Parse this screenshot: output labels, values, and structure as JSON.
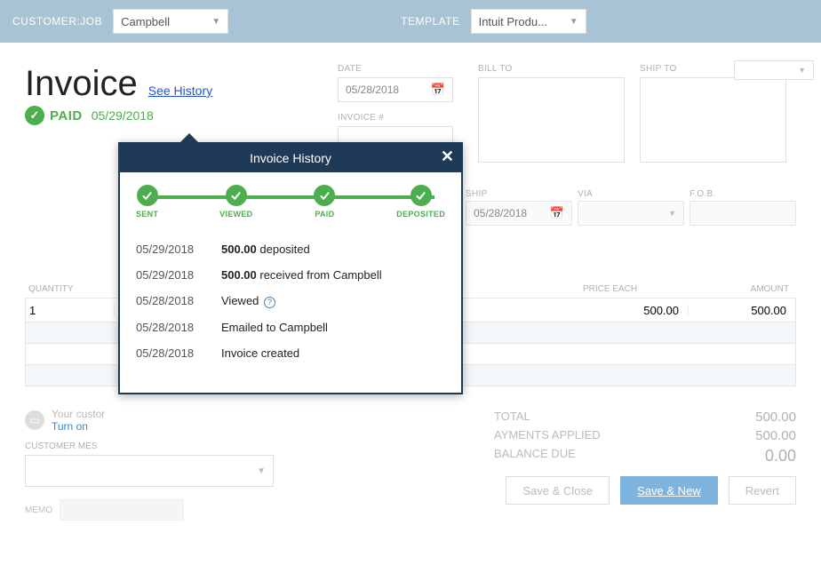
{
  "topbar": {
    "customer_label": "CUSTOMER:JOB",
    "customer_value": "Campbell",
    "template_label": "TEMPLATE",
    "template_value": "Intuit Produ..."
  },
  "header": {
    "title": "Invoice",
    "see_history": "See History",
    "paid_label": "PAID",
    "paid_date": "05/29/2018"
  },
  "fields": {
    "date_label": "DATE",
    "date_value": "05/28/2018",
    "invoice_no_label": "INVOICE #",
    "bill_to_label": "BILL TO",
    "ship_to_label": "SHIP TO",
    "ship_label": "SHIP",
    "ship_value": "05/28/2018",
    "via_label": "VIA",
    "fob_label": "F.O.B."
  },
  "table": {
    "col_qty": "QUANTITY",
    "col_price": "PRICE EACH",
    "col_amount": "AMOUNT",
    "rows": [
      {
        "qty": "1",
        "price": "500.00",
        "amount": "500.00"
      }
    ]
  },
  "customer_msg": {
    "online_pay": "Your custor",
    "turn_on": "Turn on",
    "label": "CUSTOMER MES"
  },
  "totals": {
    "total_label": "TOTAL",
    "total_value": "500.00",
    "payments_label": "AYMENTS APPLIED",
    "payments_value": "500.00",
    "balance_label": "BALANCE DUE",
    "balance_value": "0.00"
  },
  "memo": {
    "label": "MEMO"
  },
  "buttons": {
    "save_close": "Save & Close",
    "save_new": "Save & New",
    "revert": "Revert"
  },
  "popup": {
    "title": "Invoice History",
    "steps": [
      "SENT",
      "VIEWED",
      "PAID",
      "DEPOSITED"
    ],
    "history": [
      {
        "date": "05/29/2018",
        "prefix": "500.00",
        "suffix": " deposited"
      },
      {
        "date": "05/29/2018",
        "prefix": "500.00",
        "suffix": " received from Campbell"
      },
      {
        "date": "05/28/2018",
        "prefix": "",
        "suffix": "Viewed",
        "info": true
      },
      {
        "date": "05/28/2018",
        "prefix": "",
        "suffix": "Emailed to Campbell"
      },
      {
        "date": "05/28/2018",
        "prefix": "",
        "suffix": "Invoice created"
      }
    ]
  }
}
